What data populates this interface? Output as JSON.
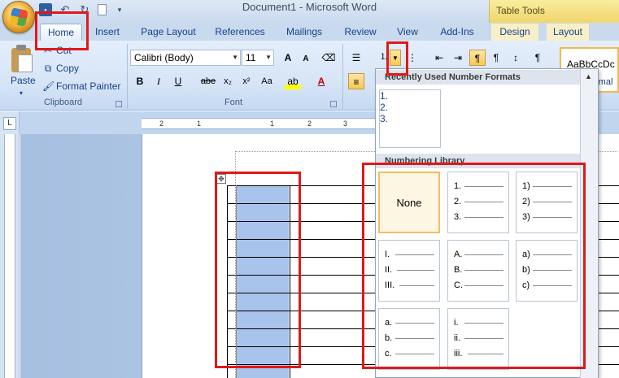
{
  "window": {
    "title": "Document1 - Microsoft Word",
    "context_tab_group": "Table Tools"
  },
  "tabs": [
    {
      "label": "Home",
      "active": true
    },
    {
      "label": "Insert"
    },
    {
      "label": "Page Layout"
    },
    {
      "label": "References"
    },
    {
      "label": "Mailings"
    },
    {
      "label": "Review"
    },
    {
      "label": "View"
    },
    {
      "label": "Add-Ins"
    },
    {
      "label": "Design"
    },
    {
      "label": "Layout"
    }
  ],
  "clipboard": {
    "paste_label": "Paste",
    "cut_label": "Cut",
    "copy_label": "Copy",
    "format_painter_label": "Format Painter",
    "group_label": "Clipboard"
  },
  "font": {
    "family": "Calibri (Body)",
    "size": "11",
    "group_label": "Font",
    "grow_glyph": "A",
    "shrink_glyph": "A",
    "bold": "B",
    "italic": "I",
    "underline": "U",
    "strike": "abe",
    "subscript": "x₂",
    "superscript": "x²",
    "aa": "Aa",
    "font_color": "A"
  },
  "styles": {
    "sample": "AaBbCcDc",
    "label": "rmal"
  },
  "gallery": {
    "recent_header": "Recently Used Number Formats",
    "library_header": "Numbering Library",
    "recent": [
      "1.",
      "2.",
      "3."
    ],
    "none_label": "None",
    "formats": [
      [
        "1.",
        "2.",
        "3."
      ],
      [
        "1)",
        "2)",
        "3)"
      ],
      [
        "I.",
        "II.",
        "III."
      ],
      [
        "A.",
        "B.",
        "C."
      ],
      [
        "a)",
        "b)",
        "c)"
      ],
      [
        "a.",
        "b.",
        "c."
      ],
      [
        "i.",
        "ii.",
        "iii."
      ]
    ]
  },
  "ruler": [
    "2",
    "1",
    "1",
    "2",
    "3"
  ],
  "colors": {
    "highlight_red": "#e01919",
    "selected_column": "#a8c4ec",
    "none_cell_border": "#f2be64"
  }
}
